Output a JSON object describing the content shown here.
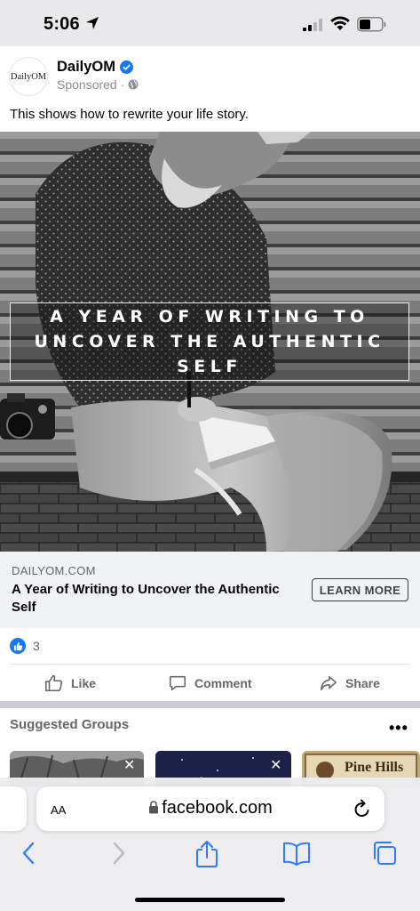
{
  "status_bar": {
    "time": "5:06"
  },
  "post": {
    "avatar_text": "DailyOM",
    "page_name": "DailyOM",
    "sponsored": "Sponsored",
    "caption": "This shows how to rewrite your life story.",
    "image_overlay": [
      "A YEAR OF WRITING TO",
      "UNCOVER THE AUTHENTIC",
      "SELF"
    ],
    "link_domain": "DAILYOM.COM",
    "link_title": "A Year of Writing to Uncover the Authentic Self",
    "cta": "LEARN MORE",
    "reaction_count": "3",
    "actions": {
      "like": "Like",
      "comment": "Comment",
      "share": "Share"
    }
  },
  "suggested_groups": {
    "title": "Suggested Groups",
    "more": "•••",
    "cards": [
      {
        "close": "✕"
      },
      {
        "close": "✕"
      },
      {
        "badge_text": "Pine Hills"
      }
    ]
  },
  "browser": {
    "text_size_label": "AA",
    "url": "facebook.com"
  },
  "colors": {
    "brand_blue": "#1877f2",
    "ios_blue": "#2f7cf6"
  }
}
